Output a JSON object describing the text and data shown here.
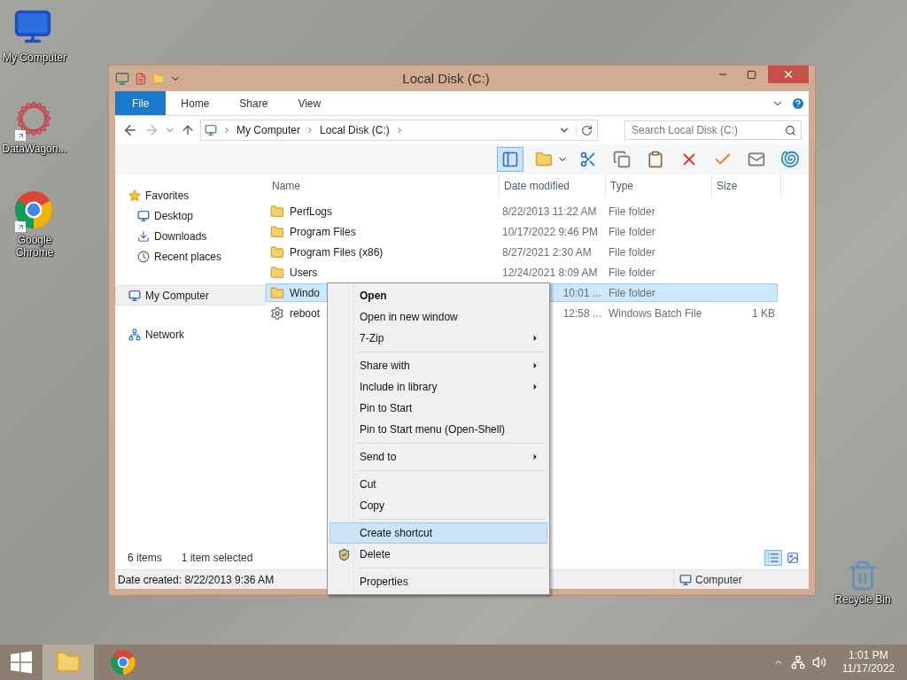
{
  "desktop_icons": [
    {
      "label": "My Computer",
      "kind": "computer",
      "shortcut": false
    },
    {
      "label": "DataWagon...",
      "kind": "star",
      "shortcut": true
    },
    {
      "label": "Google Chrome",
      "kind": "chrome",
      "shortcut": true
    }
  ],
  "recycle_bin": {
    "label": "Recycle Bin"
  },
  "window": {
    "title": "Local Disk (C:)"
  },
  "ribbon_tabs": [
    {
      "label": "File",
      "kind": "file"
    },
    {
      "label": "Home",
      "kind": "tab"
    },
    {
      "label": "Share",
      "kind": "tab"
    },
    {
      "label": "View",
      "kind": "tab"
    }
  ],
  "address": {
    "segments": [
      "My Computer",
      "Local Disk (C:)"
    ]
  },
  "search": {
    "placeholder": "Search Local Disk (C:)"
  },
  "nav": [
    {
      "label": "Favorites",
      "kind": "star",
      "selected": false,
      "children": [
        {
          "label": "Desktop",
          "kind": "desktop",
          "selected": false
        },
        {
          "label": "Downloads",
          "kind": "downloads",
          "selected": false
        },
        {
          "label": "Recent places",
          "kind": "recent",
          "selected": false
        }
      ]
    },
    {
      "label": "My Computer",
      "kind": "computer",
      "selected": true
    },
    {
      "label": "Network",
      "kind": "network",
      "selected": false
    }
  ],
  "columns": [
    "Name",
    "Date modified",
    "Type",
    "Size"
  ],
  "rows": [
    {
      "name": "PerfLogs",
      "date": "8/22/2013 11:22 AM",
      "type": "File folder",
      "kind": "folder",
      "selected": false,
      "date_clipped": false
    },
    {
      "name": "Program Files",
      "date": "10/17/2022 9:46 PM",
      "type": "File folder",
      "kind": "folder",
      "selected": false,
      "date_clipped": false
    },
    {
      "name": "Program Files (x86)",
      "date": "8/27/2021 2:30 AM",
      "type": "File folder",
      "kind": "folder",
      "selected": false,
      "date_clipped": false
    },
    {
      "name": "Users",
      "date": "12/24/2021 8:09 AM",
      "type": "File folder",
      "kind": "folder",
      "selected": false,
      "date_clipped": false
    },
    {
      "name": "Windo",
      "date": "10:01 ...",
      "type": "File folder",
      "kind": "folder",
      "selected": true,
      "date_clipped": true
    },
    {
      "name": "reboot",
      "date": "12:58 ...",
      "type": "Windows Batch File",
      "size": "1 KB",
      "kind": "batch",
      "selected": false,
      "date_clipped": true
    }
  ],
  "status": {
    "count": "6 items",
    "selection": "1 item selected"
  },
  "views": [
    {
      "kind": "details",
      "selected": true
    },
    {
      "kind": "large",
      "selected": false
    }
  ],
  "details_bar": {
    "info": "Date created: 8/22/2013 9:36 AM",
    "location": "Computer"
  },
  "context_menu": {
    "groups": [
      [
        {
          "label": "Open",
          "bold": true,
          "submenu": false,
          "kind": "plain",
          "selected": false
        },
        {
          "label": "Open in new window",
          "bold": false,
          "submenu": false,
          "kind": "plain",
          "selected": false
        },
        {
          "label": "7-Zip",
          "bold": false,
          "submenu": true,
          "kind": "plain",
          "selected": false
        }
      ],
      [
        {
          "label": "Share with",
          "bold": false,
          "submenu": true,
          "kind": "plain",
          "selected": false
        },
        {
          "label": "Include in library",
          "bold": false,
          "submenu": true,
          "kind": "plain",
          "selected": false
        },
        {
          "label": "Pin to Start",
          "bold": false,
          "submenu": false,
          "kind": "plain",
          "selected": false
        },
        {
          "label": "Pin to Start menu (Open-Shell)",
          "bold": false,
          "submenu": false,
          "kind": "plain",
          "selected": false
        }
      ],
      [
        {
          "label": "Send to",
          "bold": false,
          "submenu": true,
          "kind": "plain",
          "selected": false
        }
      ],
      [
        {
          "label": "Cut",
          "bold": false,
          "submenu": false,
          "kind": "plain",
          "selected": false
        },
        {
          "label": "Copy",
          "bold": false,
          "submenu": false,
          "kind": "plain",
          "selected": false
        }
      ],
      [
        {
          "label": "Create shortcut",
          "bold": false,
          "submenu": false,
          "kind": "plain",
          "selected": true
        },
        {
          "label": "Delete",
          "bold": false,
          "submenu": false,
          "kind": "shield",
          "selected": false
        }
      ],
      [
        {
          "label": "Properties",
          "bold": false,
          "submenu": false,
          "kind": "plain",
          "selected": false
        }
      ]
    ]
  },
  "taskbar": {
    "apps": [
      {
        "kind": "explorer",
        "selected": true
      },
      {
        "kind": "chrome",
        "selected": false
      }
    ],
    "time": "1:01 PM",
    "date": "11/17/2022"
  }
}
